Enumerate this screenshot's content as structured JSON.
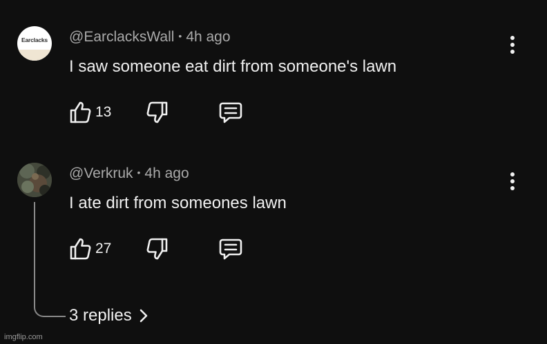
{
  "comments": [
    {
      "avatar_text": "Earclacks",
      "author": "@EarclacksWall",
      "time": "4h ago",
      "text": "I saw someone eat dirt from someone's lawn",
      "likes": "13"
    },
    {
      "author": "@Verkruk",
      "time": "4h ago",
      "text": "I ate dirt from someones lawn",
      "likes": "27"
    }
  ],
  "replies": {
    "label": "3 replies"
  },
  "watermark": "imgflip.com",
  "icons": {
    "like": "thumbs-up-icon",
    "dislike": "thumbs-down-icon",
    "reply": "comment-icon",
    "menu": "more-vert-icon",
    "expand": "chevron-right-icon"
  }
}
